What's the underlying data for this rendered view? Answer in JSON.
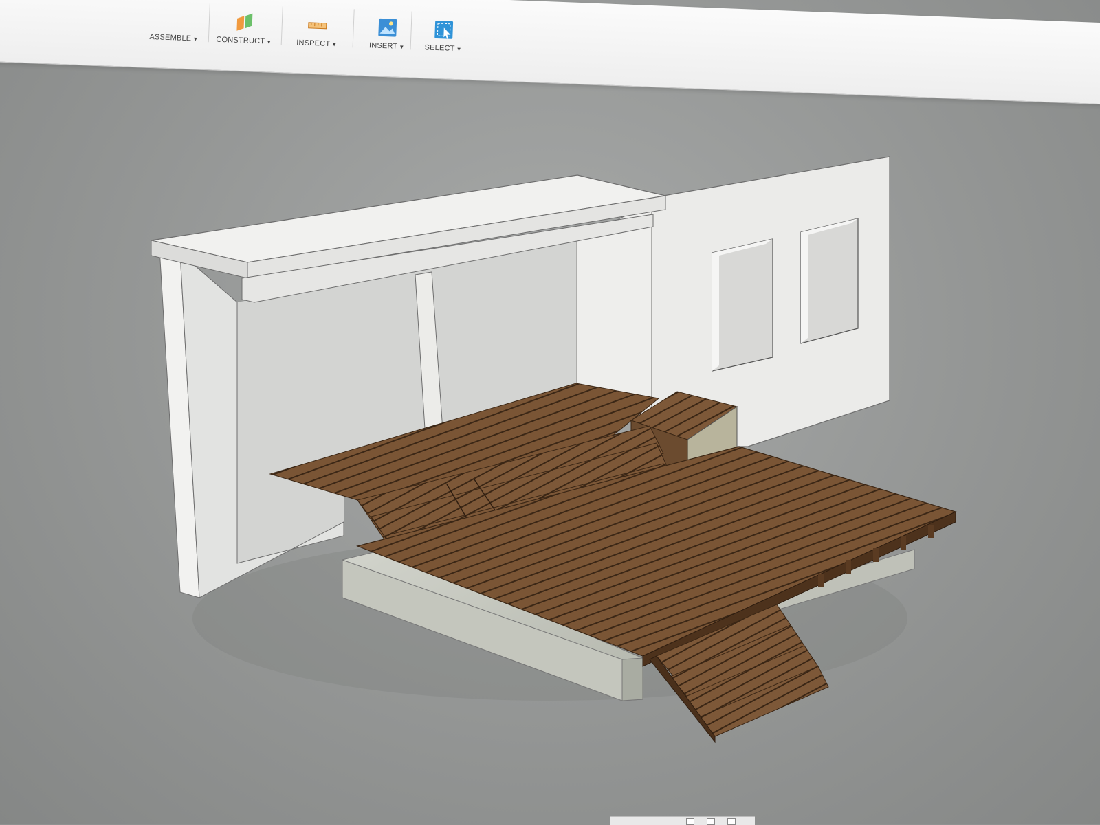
{
  "toolbar": {
    "assemble_label": "ASSEMBLE",
    "construct_label": "CONSTRUCT",
    "inspect_label": "INSPECT",
    "insert_label": "INSERT",
    "select_label": "SELECT",
    "icons": {
      "construct": "construct-plane-icon",
      "inspect": "measure-ruler-icon",
      "insert": "insert-image-icon",
      "select": "select-cursor-icon"
    }
  },
  "viewport": {
    "model": "deck-and-covered-patio-3d-model",
    "colors": {
      "background": "#8f9190",
      "wall": "#e8e8e6",
      "wood": "#6e4c2f",
      "concrete": "#c7c9c1"
    }
  }
}
